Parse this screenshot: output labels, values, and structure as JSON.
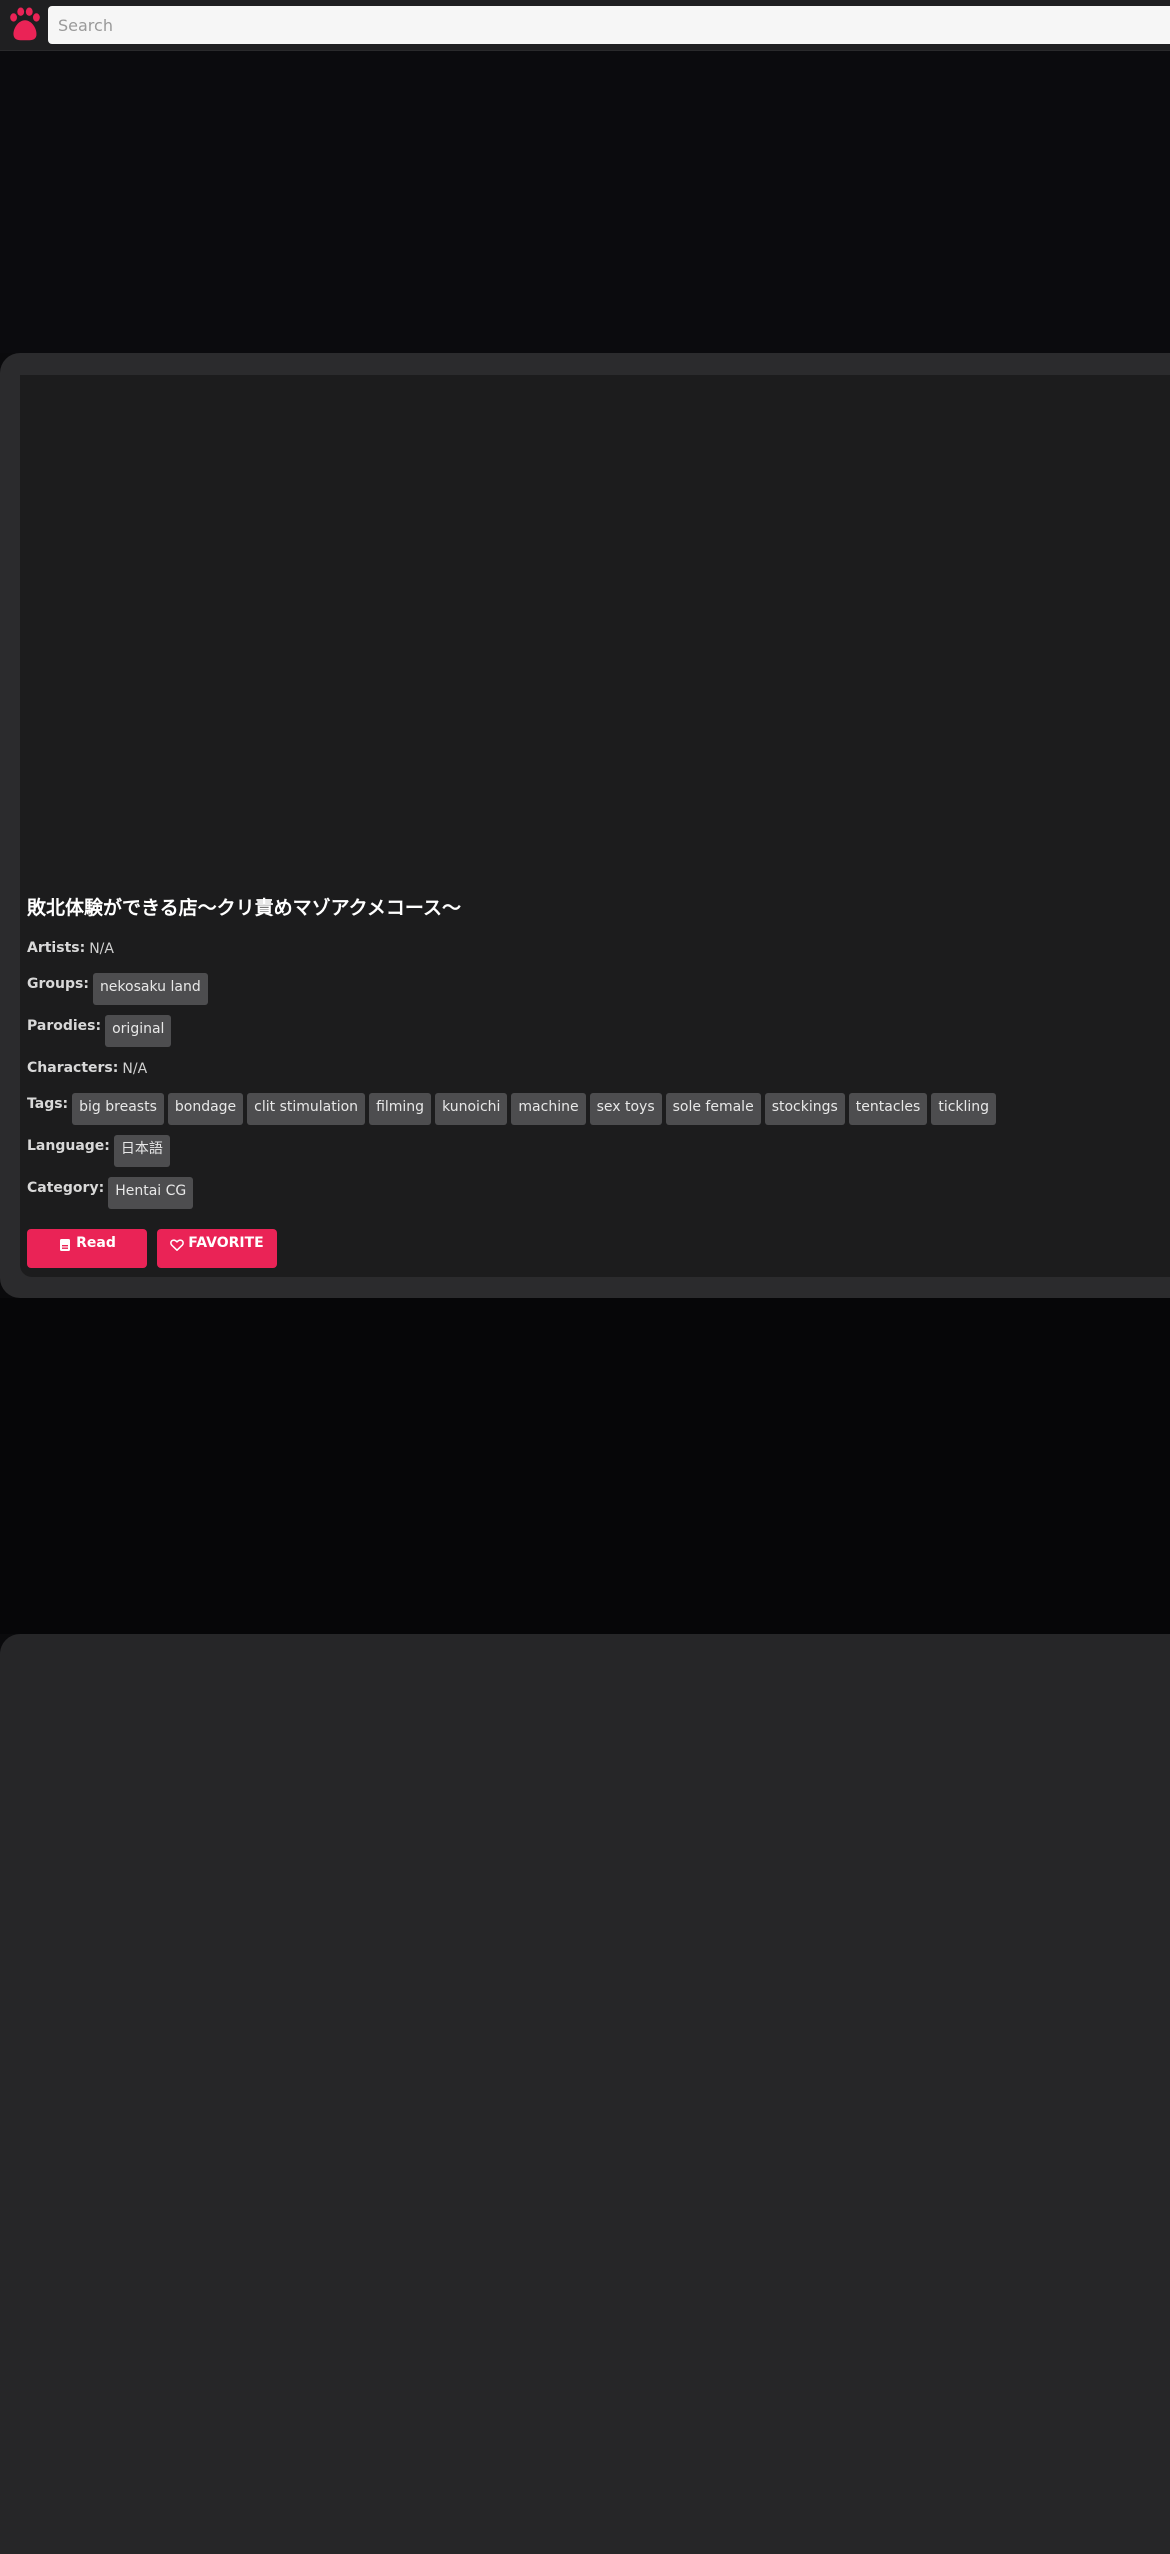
{
  "header": {
    "logo_icon": "paw-icon",
    "search_placeholder": "Search"
  },
  "gallery": {
    "title": "敗北体験ができる店〜クリ責めマゾアクメコース〜",
    "artists_label": "Artists:",
    "artists_value": "N/A",
    "groups_label": "Groups:",
    "groups": [
      "nekosaku land"
    ],
    "parodies_label": "Parodies:",
    "parodies": [
      "original"
    ],
    "characters_label": "Characters:",
    "characters_value": "N/A",
    "tags_label": "Tags:",
    "tags": [
      "big breasts",
      "bondage",
      "clit stimulation",
      "filming",
      "kunoichi",
      "machine",
      "sex toys",
      "sole female",
      "stockings",
      "tentacles",
      "tickling"
    ],
    "language_label": "Language:",
    "languages": [
      "日本語"
    ],
    "category_label": "Category:",
    "categories": [
      "Hentai CG"
    ]
  },
  "actions": {
    "read_label": "Read",
    "read_icon": "book-icon",
    "favorite_label": "FAVORITE",
    "favorite_icon": "heart-icon"
  },
  "colors": {
    "accent": "#ea2356",
    "chip": "#4d4d4f",
    "panel": "#2b2b2d",
    "panel_inner": "#1c1c1d"
  }
}
